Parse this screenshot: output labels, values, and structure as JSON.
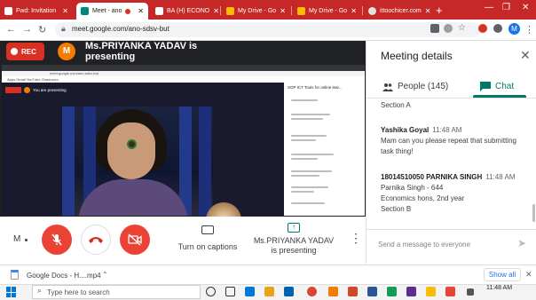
{
  "browser": {
    "tabs": [
      {
        "label": "Fwd: Invitation",
        "color": "#ea4335"
      },
      {
        "label": "Meet - ano",
        "color": "#00897b"
      },
      {
        "label": "BA (H) ECONO",
        "color": "#5f6368"
      },
      {
        "label": "My Drive - Go",
        "color": "#fbbc04"
      },
      {
        "label": "My Drive - Go",
        "color": "#fbbc04"
      },
      {
        "label": "ittoochicer.com",
        "color": "#9e9e9e"
      }
    ],
    "url": "meet.google.com/ano-sdsv-but",
    "profile_initial": "M"
  },
  "meet": {
    "rec_label": "REC",
    "presenter_initial": "M",
    "presenting_text": "Ms.PRIYANKA YADAV is presenting",
    "shared": {
      "url": "meet.google.com/ano-sdsv-but",
      "bookmarks": "Apps   Gmail   YouTube   Classroom",
      "you_are_presenting": "You are presenting",
      "panel_title": "SOP ICT Tools for online lear..."
    },
    "controls": {
      "self_initial": "M",
      "captions_label": "Turn on captions",
      "presenting_label": "Ms.PRIYANKA YADAV is presenting"
    }
  },
  "panel": {
    "title": "Meeting details",
    "people_tab": "People (145)",
    "chat_tab": "Chat",
    "section_top": "Section A",
    "messages": [
      {
        "name": "Yashika Goyal",
        "time": "11:48 AM",
        "lines": [
          "Mam can you please repeat that submitting",
          "task thing!"
        ]
      },
      {
        "name": "18014510050 PARNIKA SINGH",
        "time": "11:48 AM",
        "lines": [
          "Parnika Singh - 644",
          "Economics hons, 2nd year",
          "Section B"
        ]
      }
    ],
    "input_placeholder": "Send a message to everyone"
  },
  "downloads": {
    "file": "Google Docs - H....mp4",
    "show_all": "Show all"
  },
  "taskbar": {
    "search_placeholder": "Type here to search",
    "time": "11:48 AM"
  }
}
